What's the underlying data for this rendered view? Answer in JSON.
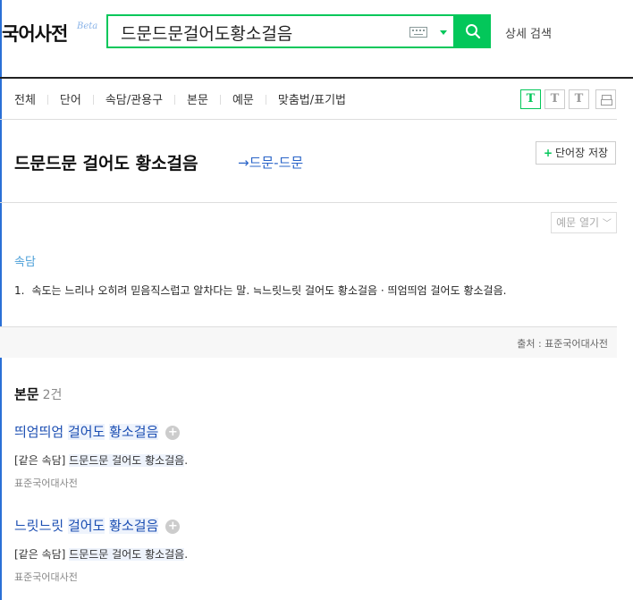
{
  "header": {
    "logo": "국어사전",
    "beta": "Beta",
    "search_value": "드문드문걸어도황소걸음",
    "advanced_search": "상세 검색"
  },
  "tabs": [
    "전체",
    "단어",
    "속담/관용구",
    "본문",
    "예문",
    "맞춤법/표기법"
  ],
  "font_buttons": [
    "T",
    "T",
    "T"
  ],
  "entry": {
    "title": "드문드문 걸어도 황소걸음",
    "ref": "→드문-드문",
    "save_label": "단어장 저장",
    "example_toggle": "예문 열기",
    "pos": "속담",
    "definition_num": "1.",
    "definition": "속도는 느리나 오히려 믿음직스럽고 알차다는 말. ≒느릿느릿 걸어도 황소걸음 · 띄엄띄엄 걸어도 황소걸음.",
    "source": "출처 : 표준국어대사전"
  },
  "body_section": {
    "title": "본문",
    "count": "2건",
    "results": [
      {
        "title_pre": "띄엄띄엄 ",
        "title_hl1": "걸어도",
        "title_mid": " ",
        "title_hl2": "황소걸음",
        "desc_pre": "[같은 속담] ",
        "desc_hl": "드문드문 걸어도 황소걸음",
        "desc_post": ".",
        "source": "표준국어대사전"
      },
      {
        "title_pre": "느릿느릿 ",
        "title_hl1": "걸어도",
        "title_mid": " ",
        "title_hl2": "황소걸음",
        "desc_pre": "[같은 속담] ",
        "desc_hl": "드문드문 걸어도 황소걸음",
        "desc_post": ".",
        "source": "표준국어대사전"
      }
    ]
  }
}
